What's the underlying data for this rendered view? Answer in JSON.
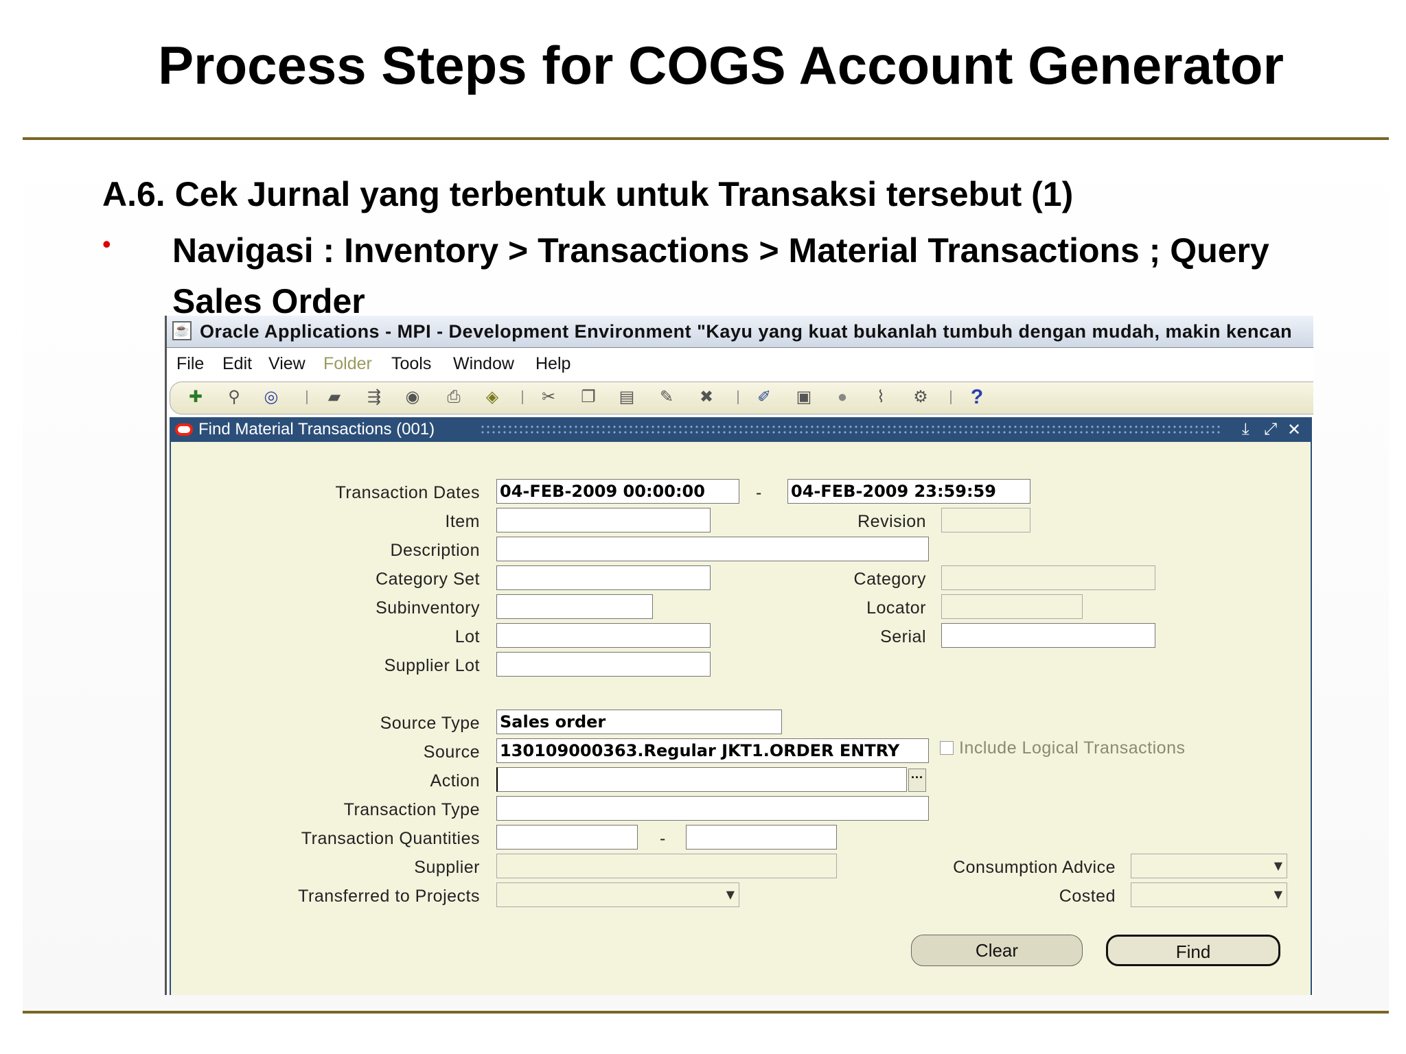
{
  "slide": {
    "title": "Process Steps for COGS Account Generator",
    "subheading": "A.6. Cek Jurnal yang terbentuk untuk Transaksi tersebut (1)",
    "bullet": "•",
    "navigation": "Navigasi : Inventory > Transactions > Material Transactions ; Query Sales Order"
  },
  "window": {
    "title": "Oracle Applications - MPI - Development Environment \"Kayu yang kuat bukanlah tumbuh dengan mudah, makin kencan",
    "menu": [
      "File",
      "Edit",
      "View",
      "Folder",
      "Tools",
      "Window",
      "Help"
    ],
    "toolbar_icons": [
      "new-icon",
      "find-icon",
      "navigator-icon",
      "save-icon",
      "next-step-icon",
      "switch-responsibility-icon",
      "print-icon",
      "close-form-icon",
      "cut-icon",
      "copy-icon",
      "paste-icon",
      "clear-record-icon",
      "delete-icon",
      "edit-field-icon",
      "zoom-icon",
      "translations-icon",
      "attachments-icon",
      "folder-tools-icon",
      "help-icon"
    ]
  },
  "dialog": {
    "title": "Find Material Transactions (001)",
    "labels": {
      "transaction_dates": "Transaction Dates",
      "item": "Item",
      "revision": "Revision",
      "description": "Description",
      "category_set": "Category Set",
      "category": "Category",
      "subinventory": "Subinventory",
      "locator": "Locator",
      "lot": "Lot",
      "serial": "Serial",
      "supplier_lot": "Supplier Lot",
      "source_type": "Source Type",
      "source": "Source",
      "action": "Action",
      "transaction_type": "Transaction Type",
      "transaction_quantities": "Transaction Quantities",
      "supplier": "Supplier",
      "consumption_advice": "Consumption Advice",
      "transferred_to_projects": "Transferred to Projects",
      "costed": "Costed",
      "include_logical": "Include Logical Transactions"
    },
    "values": {
      "date_from": "04-FEB-2009 00:00:00",
      "date_sep": "-",
      "date_to": "04-FEB-2009 23:59:59",
      "source_type": "Sales order",
      "source": "130109000363.Regular JKT1.ORDER ENTRY",
      "qty_sep": "-",
      "include_logical_checked": false
    },
    "buttons": {
      "clear": "Clear",
      "find": "Find"
    }
  }
}
